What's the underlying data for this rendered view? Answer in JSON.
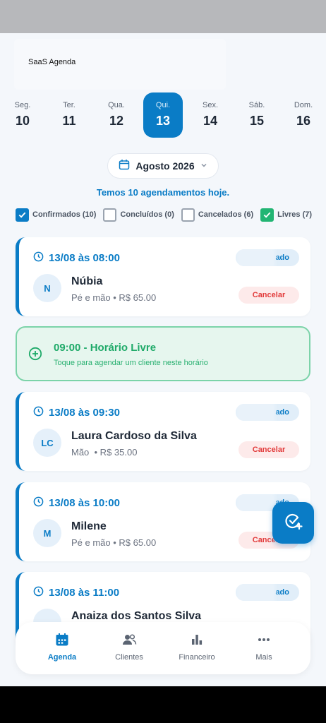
{
  "app": {
    "brand": "SaaS Agenda"
  },
  "week": [
    {
      "name": "Seg.",
      "day": "10",
      "active": false
    },
    {
      "name": "Ter.",
      "day": "11",
      "active": false
    },
    {
      "name": "Qua.",
      "day": "12",
      "active": false
    },
    {
      "name": "Qui.",
      "day": "13",
      "active": true
    },
    {
      "name": "Sex.",
      "day": "14",
      "active": false
    },
    {
      "name": "Sáb.",
      "day": "15",
      "active": false
    },
    {
      "name": "Dom.",
      "day": "16",
      "active": false
    }
  ],
  "month": {
    "label": "Agosto 2026"
  },
  "summary": "Temos 10 agendamentos hoje.",
  "filters": [
    {
      "label": "Confirmados (10)",
      "checked": true,
      "color": "#0a7cc6"
    },
    {
      "label": "Concluídos (0)",
      "checked": false
    },
    {
      "label": "Cancelados (6)",
      "checked": false
    },
    {
      "label": "Livres (7)",
      "checked": true,
      "color": "#22b573"
    }
  ],
  "appointments": [
    {
      "time": "13/08 às 08:00",
      "status": "ado",
      "initials": "N",
      "name": "Núbia",
      "info": "Pé e mão • R$ 65.00",
      "cancel": "Cancelar"
    },
    {
      "time": "13/08 às 09:30",
      "status": "ado",
      "initials": "LC",
      "name": "Laura Cardoso da Silva",
      "info": "Mão  • R$ 35.00",
      "cancel": "Cancelar"
    },
    {
      "time": "13/08 às 10:00",
      "status": "ado",
      "initials": "M",
      "name": "Milene",
      "info": "Pé e mão • R$ 65.00",
      "cancel": "Cancelar"
    },
    {
      "time": "13/08 às 11:00",
      "status": "ado",
      "initials": "",
      "name": "Anaiza dos Santos Silva",
      "info": "",
      "cancel": ""
    }
  ],
  "free_slot": {
    "title": "09:00 - Horário Livre",
    "subtitle": "Toque para agendar um cliente neste horário"
  },
  "tabs": [
    {
      "label": "Agenda",
      "icon": "calendar-icon",
      "active": true
    },
    {
      "label": "Clientes",
      "icon": "users-icon",
      "active": false
    },
    {
      "label": "Financeiro",
      "icon": "bar-chart-icon",
      "active": false
    },
    {
      "label": "Mais",
      "icon": "more-dots-icon",
      "active": false
    }
  ],
  "colors": {
    "primary": "#0a7cc6",
    "free": "#22b573",
    "danger": "#e23b3b"
  }
}
